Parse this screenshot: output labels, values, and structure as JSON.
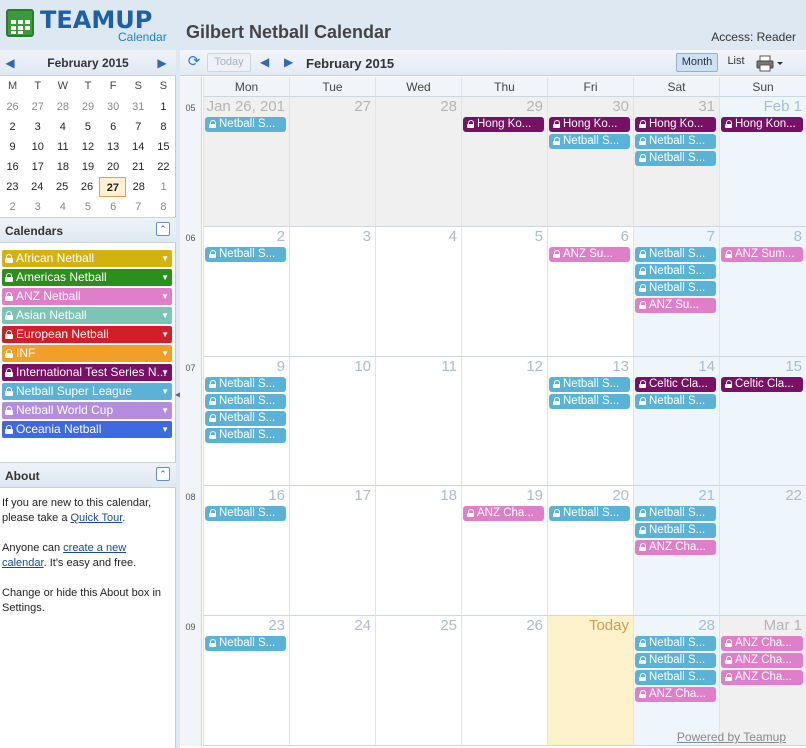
{
  "header": {
    "logo_word": "TEAMUP",
    "logo_sub": "Calendar",
    "title": "Gilbert Netball Calendar",
    "access": "Access: Reader"
  },
  "mini_calendar": {
    "title": "February 2015",
    "weekdays": [
      "M",
      "T",
      "W",
      "T",
      "F",
      "S",
      "S"
    ],
    "weeks": [
      [
        [
          "26",
          0
        ],
        [
          "27",
          0
        ],
        [
          "28",
          0
        ],
        [
          "29",
          0
        ],
        [
          "30",
          0
        ],
        [
          "31",
          0
        ],
        [
          "1",
          1
        ]
      ],
      [
        [
          "2",
          1
        ],
        [
          "3",
          1
        ],
        [
          "4",
          1
        ],
        [
          "5",
          1
        ],
        [
          "6",
          1
        ],
        [
          "7",
          1
        ],
        [
          "8",
          1
        ]
      ],
      [
        [
          "9",
          1
        ],
        [
          "10",
          1
        ],
        [
          "11",
          1
        ],
        [
          "12",
          1
        ],
        [
          "13",
          1
        ],
        [
          "14",
          1
        ],
        [
          "15",
          1
        ]
      ],
      [
        [
          "16",
          1
        ],
        [
          "17",
          1
        ],
        [
          "18",
          1
        ],
        [
          "19",
          1
        ],
        [
          "20",
          1
        ],
        [
          "21",
          1
        ],
        [
          "22",
          1
        ]
      ],
      [
        [
          "23",
          1
        ],
        [
          "24",
          1
        ],
        [
          "25",
          1
        ],
        [
          "26",
          1
        ],
        [
          "27",
          2
        ],
        [
          "28",
          1
        ],
        [
          "1",
          0
        ]
      ],
      [
        [
          "2",
          0
        ],
        [
          "3",
          0
        ],
        [
          "4",
          0
        ],
        [
          "5",
          0
        ],
        [
          "6",
          0
        ],
        [
          "7",
          0
        ],
        [
          "8",
          0
        ]
      ]
    ]
  },
  "calendars": {
    "heading": "Calendars",
    "items": [
      {
        "label": "African Netball",
        "color": "#d4b10f"
      },
      {
        "label": "Americas Netball",
        "color": "#2c8f1c"
      },
      {
        "label": "ANZ Netball",
        "color": "#e07fc9"
      },
      {
        "label": "Asian Netball",
        "color": "#7cc4b3"
      },
      {
        "label": "European Netball",
        "color": "#cf2028"
      },
      {
        "label": "INF",
        "color": "#f0a02a"
      },
      {
        "label": "International Test Series N...",
        "color": "#7a1065"
      },
      {
        "label": "Netball Super League",
        "color": "#5ab3d6"
      },
      {
        "label": "Netball World Cup",
        "color": "#b58de0"
      },
      {
        "label": "Oceania Netball",
        "color": "#3d6ae0"
      }
    ]
  },
  "about": {
    "heading": "About",
    "p1_a": "If you are new to this calendar, please take a ",
    "p1_link": "Quick Tour",
    "p1_b": ".",
    "p2_a": "Anyone can ",
    "p2_link": "create a new calendar",
    "p2_b": ". It's easy and free.",
    "p3": "Change or hide this About box in Settings."
  },
  "toolbar": {
    "today": "Today",
    "month_label": "February 2015",
    "view_month": "Month",
    "view_list": "List"
  },
  "grid": {
    "weekdays": [
      "Mon",
      "Tue",
      "Wed",
      "Thu",
      "Fri",
      "Sat",
      "Sun"
    ],
    "week_numbers": [
      "05",
      "06",
      "07",
      "08",
      "09"
    ],
    "weeks": [
      {
        "days": [
          [
            "Jan 26, 201",
            "other"
          ],
          [
            "27",
            "other"
          ],
          [
            "28",
            "other"
          ],
          [
            "29",
            "other"
          ],
          [
            "30",
            "other"
          ],
          [
            "31",
            "other"
          ],
          [
            "Feb 1",
            "weekend"
          ]
        ],
        "events": [
          [
            0,
            0,
            "Netball S...",
            "super"
          ],
          [
            3,
            0,
            "Hong Ko...",
            "its"
          ],
          [
            4,
            0,
            "Hong Ko...",
            "its"
          ],
          [
            4,
            1,
            "Netball S...",
            "super"
          ],
          [
            5,
            0,
            "Hong Ko...",
            "its"
          ],
          [
            5,
            1,
            "Netball S...",
            "super"
          ],
          [
            5,
            2,
            "Netball S...",
            "super"
          ],
          [
            6,
            0,
            "Hong Kon...",
            "its"
          ]
        ]
      },
      {
        "days": [
          [
            "2",
            "cur"
          ],
          [
            "3",
            "cur"
          ],
          [
            "4",
            "cur"
          ],
          [
            "5",
            "cur"
          ],
          [
            "6",
            "cur"
          ],
          [
            "7",
            "weekend"
          ],
          [
            "8",
            "weekend"
          ]
        ],
        "events": [
          [
            0,
            0,
            "Netball S...",
            "super"
          ],
          [
            4,
            0,
            "ANZ Su...",
            "anz"
          ],
          [
            5,
            0,
            "Netball S...",
            "super"
          ],
          [
            5,
            1,
            "Netball S...",
            "super"
          ],
          [
            5,
            2,
            "Netball S...",
            "super"
          ],
          [
            5,
            3,
            "ANZ Su...",
            "anz"
          ],
          [
            6,
            0,
            "ANZ Sum...",
            "anz"
          ]
        ]
      },
      {
        "days": [
          [
            "9",
            "cur"
          ],
          [
            "10",
            "cur"
          ],
          [
            "11",
            "cur"
          ],
          [
            "12",
            "cur"
          ],
          [
            "13",
            "cur"
          ],
          [
            "14",
            "weekend"
          ],
          [
            "15",
            "weekend"
          ]
        ],
        "events": [
          [
            0,
            0,
            "Netball S...",
            "super"
          ],
          [
            0,
            1,
            "Netball S...",
            "super"
          ],
          [
            0,
            2,
            "Netball S...",
            "super"
          ],
          [
            0,
            3,
            "Netball S...",
            "super"
          ],
          [
            4,
            0,
            "Netball S...",
            "super"
          ],
          [
            4,
            1,
            "Netball S...",
            "super"
          ],
          [
            5,
            0,
            "Celtic Cla...",
            "its"
          ],
          [
            5,
            1,
            "Netball S...",
            "super"
          ],
          [
            6,
            0,
            "Celtic Cla...",
            "its"
          ]
        ]
      },
      {
        "days": [
          [
            "16",
            "cur"
          ],
          [
            "17",
            "cur"
          ],
          [
            "18",
            "cur"
          ],
          [
            "19",
            "cur"
          ],
          [
            "20",
            "cur"
          ],
          [
            "21",
            "weekend"
          ],
          [
            "22",
            "weekend"
          ]
        ],
        "events": [
          [
            0,
            0,
            "Netball S...",
            "super"
          ],
          [
            3,
            0,
            "ANZ Cha...",
            "anz"
          ],
          [
            4,
            0,
            "Netball S...",
            "super"
          ],
          [
            5,
            0,
            "Netball S...",
            "super"
          ],
          [
            5,
            1,
            "Netball S...",
            "super"
          ],
          [
            5,
            2,
            "ANZ Cha...",
            "anz"
          ]
        ]
      },
      {
        "days": [
          [
            "23",
            "cur"
          ],
          [
            "24",
            "cur"
          ],
          [
            "25",
            "cur"
          ],
          [
            "26",
            "cur"
          ],
          [
            "Today",
            "today"
          ],
          [
            "28",
            "weekend"
          ],
          [
            "Mar 1",
            "other"
          ]
        ],
        "events": [
          [
            0,
            0,
            "Netball S...",
            "super"
          ],
          [
            5,
            0,
            "Netball S...",
            "super"
          ],
          [
            5,
            1,
            "Netball S...",
            "super"
          ],
          [
            5,
            2,
            "Netball S...",
            "super"
          ],
          [
            5,
            3,
            "ANZ Cha...",
            "anz"
          ],
          [
            6,
            0,
            "ANZ Cha...",
            "anz"
          ],
          [
            6,
            1,
            "ANZ Cha...",
            "anz"
          ],
          [
            6,
            2,
            "ANZ Cha...",
            "anz"
          ]
        ]
      }
    ],
    "event_colors": {
      "super": "#5ab3d6",
      "its": "#7a1065",
      "anz": "#e07fc9"
    }
  },
  "footer": {
    "powered": "Powered by Teamup"
  }
}
